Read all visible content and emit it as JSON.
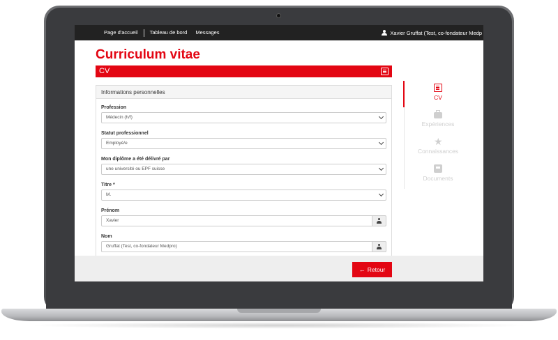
{
  "topbar": {
    "nav": [
      {
        "label": "Page d'accueil"
      },
      {
        "label": "Tableau de bord"
      },
      {
        "label": "Messages"
      }
    ],
    "user_name": "Xavier Gruffat (Test, co-fondateur Medp"
  },
  "page": {
    "title": "Curriculum vitae",
    "section_label": "CV"
  },
  "panel": {
    "heading": "Informations personnelles",
    "fields": {
      "profession": {
        "label": "Profession",
        "value": "Médecin (h/f)"
      },
      "statut": {
        "label": "Statut professionnel",
        "value": "Employé/e"
      },
      "diplome": {
        "label": "Mon diplôme a été délivré par",
        "value": "une université ou EPF suisse"
      },
      "titre": {
        "label": "Titre *",
        "value": "M."
      },
      "prenom": {
        "label": "Prénom",
        "value": "Xavier"
      },
      "nom": {
        "label": "Nom",
        "value": "Gruffat (Test, co-fondateur Medpro)"
      }
    }
  },
  "side_nav": [
    {
      "label": "CV",
      "icon": "cv-icon",
      "active": true
    },
    {
      "label": "Expériences",
      "icon": "briefcase-icon",
      "active": false
    },
    {
      "label": "Connaissances",
      "icon": "star-icon",
      "active": false
    },
    {
      "label": "Documents",
      "icon": "inbox-icon",
      "active": false
    }
  ],
  "footer": {
    "back_label": "Retour"
  },
  "colors": {
    "accent": "#e30613",
    "topbar": "#222222",
    "inactive": "#cfcfcf"
  }
}
